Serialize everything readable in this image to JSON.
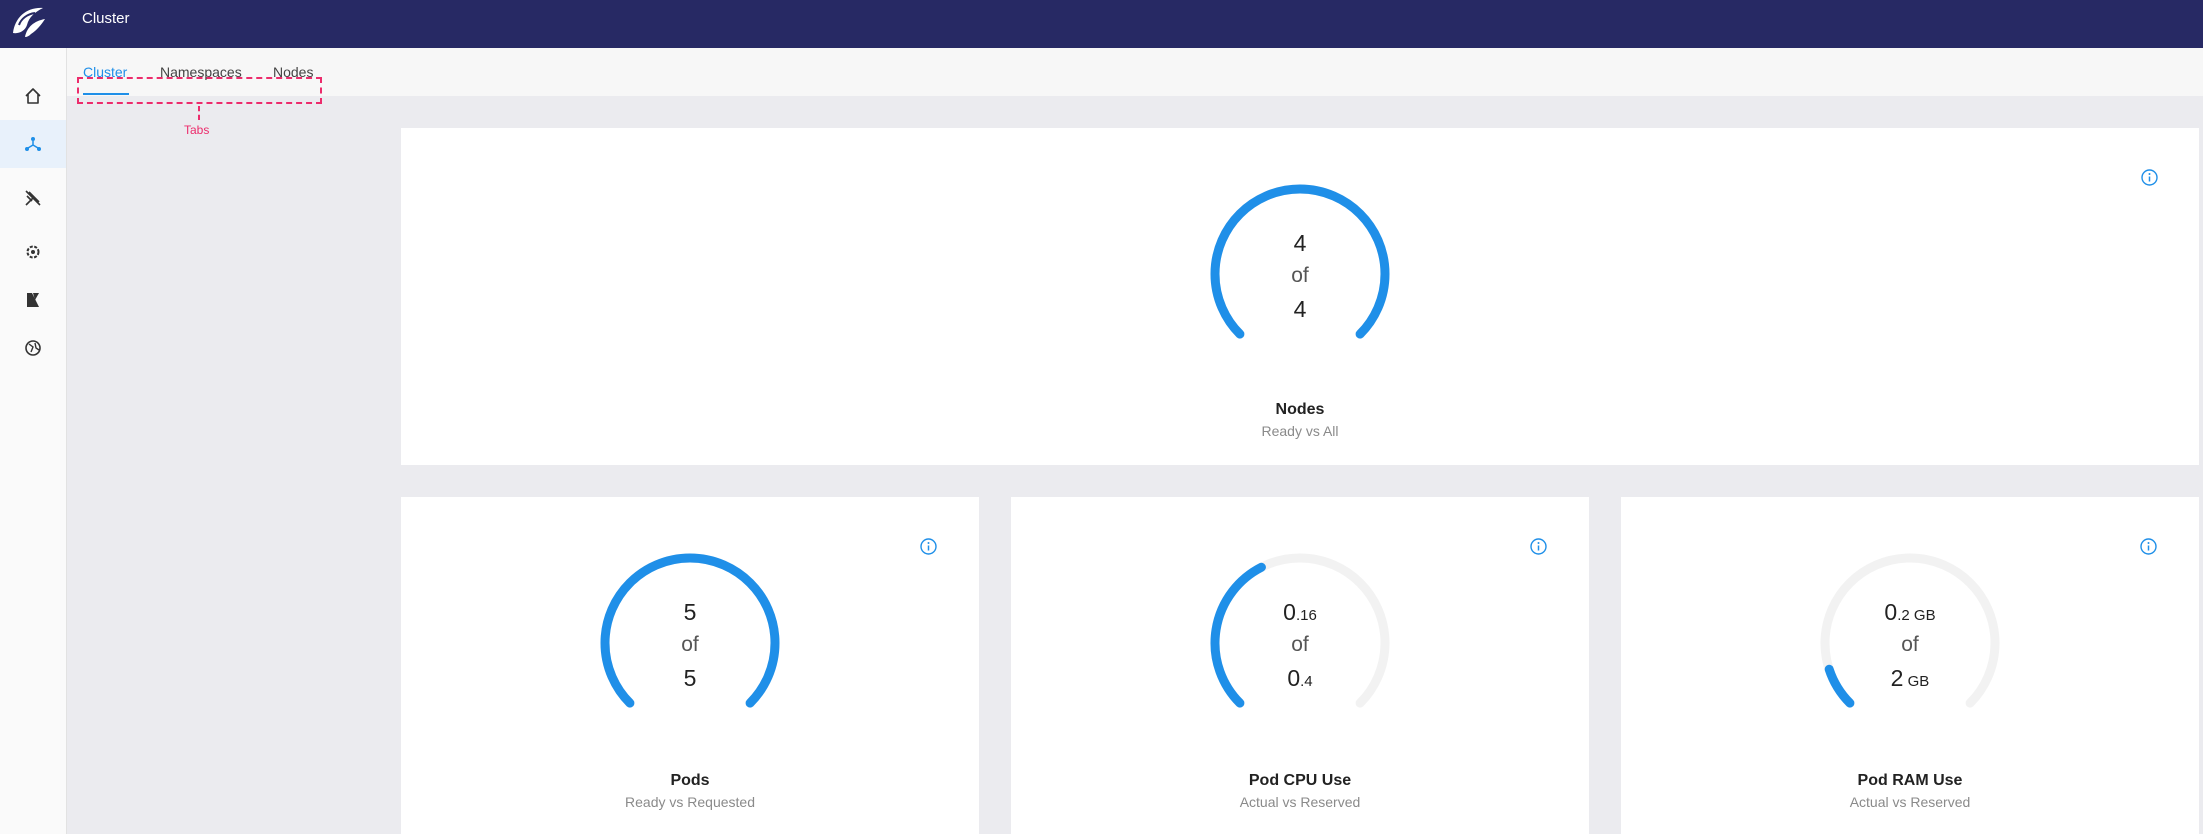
{
  "header": {
    "title": "Cluster"
  },
  "sidebar": {
    "items": [
      {
        "name": "home-icon",
        "active": false
      },
      {
        "name": "cluster-icon",
        "active": true
      },
      {
        "name": "workloads-icon",
        "active": false
      },
      {
        "name": "settings-gear-icon",
        "active": false
      },
      {
        "name": "apps-icon",
        "active": false
      },
      {
        "name": "network-globe-icon",
        "active": false
      }
    ]
  },
  "tabs": [
    {
      "label": "Cluster",
      "active": true
    },
    {
      "label": "Namespaces",
      "active": false
    },
    {
      "label": "Nodes",
      "active": false
    }
  ],
  "annotation": {
    "label": "Tabs"
  },
  "cards": {
    "nodes": {
      "title": "Nodes",
      "subtitle": "Ready vs All",
      "value": "4",
      "of": "of",
      "total": "4",
      "fraction": 1.0
    },
    "pods": {
      "title": "Pods",
      "subtitle": "Ready vs Requested",
      "value": "5",
      "of": "of",
      "total": "5",
      "fraction": 1.0
    },
    "cpu": {
      "title": "Pod CPU Use",
      "subtitle": "Actual vs Reserved",
      "value_int": "0",
      "value_dec": ".16",
      "of": "of",
      "total_int": "0",
      "total_dec": ".4",
      "fraction": 0.4
    },
    "ram": {
      "title": "Pod RAM Use",
      "subtitle": "Actual vs Reserved",
      "value_int": "0",
      "value_unit": ".2 GB",
      "of": "of",
      "total_int": "2",
      "total_unit": " GB",
      "fraction": 0.1
    }
  },
  "colors": {
    "accent": "#1f8fe8",
    "track": "#f2f2f2",
    "topbar": "#272964",
    "annotation": "#ec2c6c"
  }
}
